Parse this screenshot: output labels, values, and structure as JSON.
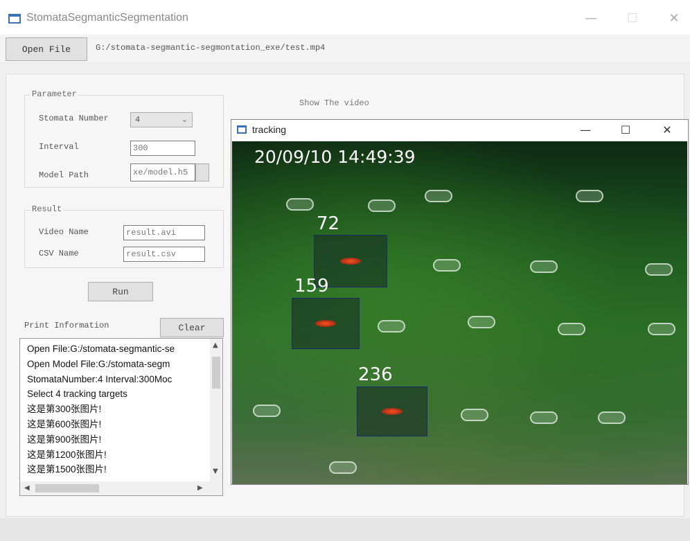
{
  "window": {
    "title": "StomataSegmanticSegmentation",
    "minimize": "—",
    "maximize": "☐",
    "close": "✕"
  },
  "toolbar": {
    "open_file_label": "Open File",
    "path": "G:/stomata-segmantic-segmontation_exe/test.mp4"
  },
  "parameter": {
    "group_title": "Parameter",
    "stomata_number_label": "Stomata Number",
    "stomata_number_value": "4",
    "interval_label": "Interval",
    "interval_value": "300",
    "model_path_label": "Model Path",
    "model_path_value": "xe/model.h5"
  },
  "result": {
    "group_title": "Result",
    "video_name_label": "Video Name",
    "video_name_value": "result.avi",
    "csv_name_label": "CSV Name",
    "csv_name_value": "result.csv"
  },
  "run_label": "Run",
  "print": {
    "label": "Print Information",
    "clear_label": "Clear",
    "lines": [
      "Open File:G:/stomata-segmantic-se",
      "Open Model File:G:/stomata-segm",
      "StomataNumber:4 Interval:300Moc",
      "Select 4 tracking targets",
      "这是第300张图片!",
      "这是第600张图片!",
      "这是第900张图片!",
      "这是第1200张图片!",
      "这是第1500张图片!"
    ]
  },
  "video": {
    "show_label": "Show The video",
    "window_title": "tracking",
    "timestamp": "20/09/10 14:49:39",
    "targets": [
      {
        "label": "72"
      },
      {
        "label": "159"
      },
      {
        "label": "236"
      }
    ]
  }
}
